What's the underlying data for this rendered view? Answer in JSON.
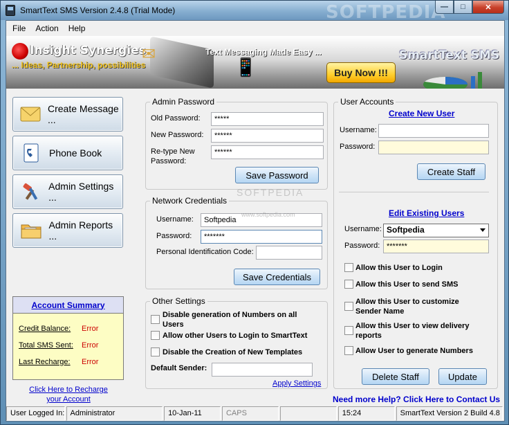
{
  "window": {
    "title": "SmartText SMS Version 2.4.8 (Trial Mode)",
    "watermark": "SOFTPEDIA",
    "buttons": {
      "minimize": "—",
      "maximize": "□",
      "close": "✕"
    }
  },
  "menu": [
    "File",
    "Action",
    "Help"
  ],
  "banner": {
    "company": "Insight Synergies",
    "tagline": "... Ideas, Partnership, possibilities",
    "slogan": "Text Messaging Made Easy ...",
    "buy_label": "Buy Now !!!",
    "product": "SmartText SMS"
  },
  "nav": [
    {
      "label": "Create Message ...",
      "icon": "envelope-icon"
    },
    {
      "label": "Phone Book",
      "icon": "phone-book-icon"
    },
    {
      "label": "Admin Settings ...",
      "icon": "admin-tools-icon"
    },
    {
      "label": "Admin Reports ...",
      "icon": "folder-reports-icon"
    }
  ],
  "account_summary": {
    "title": "Account Summary",
    "rows": [
      {
        "label": "Credit Balance:",
        "value": "Error"
      },
      {
        "label": "Total SMS Sent:",
        "value": "Error"
      },
      {
        "label": "Last Recharge:",
        "value": "Error"
      }
    ],
    "recharge_link_line1": "Click Here to Recharge",
    "recharge_link_line2": "your Account"
  },
  "admin_password": {
    "title": "Admin Password",
    "old_label": "Old Password:",
    "old_value": "*****",
    "new_label": "New Password:",
    "new_value": "******",
    "retype_label_1": "Re-type New",
    "retype_label_2": "Password:",
    "retype_value": "******",
    "save_label": "Save Password"
  },
  "network": {
    "title": "Network Credentials",
    "username_label": "Username:",
    "username_value": "Softpedia",
    "password_label": "Password:",
    "password_value": "*******",
    "pin_label": "Personal Identification Code:",
    "pin_value": "",
    "save_label": "Save Credentials"
  },
  "other_settings": {
    "title": "Other Settings",
    "opt1_line1": "Disable generation of Numbers on all",
    "opt1_line2": "Users",
    "opt2": "Allow other Users to Login to SmartText",
    "opt3": "Disable the Creation of New Templates",
    "sender_label": "Default Sender:",
    "sender_value": "",
    "apply_label": "Apply Settings"
  },
  "user_accounts": {
    "title": "User Accounts",
    "create_link": "Create New User",
    "username_label": "Username:",
    "username_value": "",
    "password_label": "Password:",
    "password_value": "",
    "create_label": "Create Staff",
    "edit_link": "Edit Existing Users",
    "edit_username_label": "Username:",
    "edit_username_value": "Softpedia",
    "edit_password_label": "Password:",
    "edit_password_value": "*******",
    "perm1": "Allow this User to Login",
    "perm2": "Allow this User to send SMS",
    "perm3_line1": "Allow this User to customize",
    "perm3_line2": "Sender Name",
    "perm4_line1": "Allow this User to view delivery",
    "perm4_line2": "reports",
    "perm5": "Allow User to generate Numbers",
    "delete_label": "Delete Staff",
    "update_label": "Update"
  },
  "help_link": "Need more Help? Click Here to Contact Us",
  "watermark_text": "SOFTPEDIA",
  "watermark_url": "www.softpedia.com",
  "statusbar": {
    "logged_label": "User Logged In:",
    "user": "Administrator",
    "date": "10-Jan-11",
    "caps": "CAPS",
    "blank": "",
    "time": "15:24",
    "version": "SmartText Version 2 Build 4.8"
  },
  "colors": {
    "link": "#0000cc",
    "error": "#cc0000",
    "summary_bg": "#fdfdc4",
    "buy_button": "#ffcf2e"
  }
}
